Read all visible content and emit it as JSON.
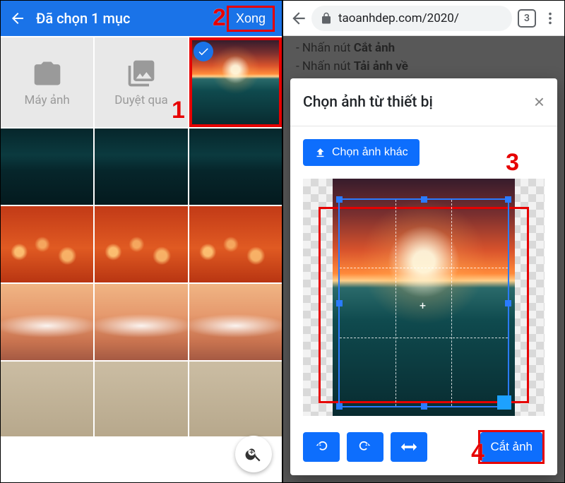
{
  "left": {
    "title": "Đã chọn 1 mục",
    "done": "Xong",
    "camera_label": "Máy ảnh",
    "browse_label": "Duyệt qua"
  },
  "right": {
    "url": "taoanhdep.com/2020/",
    "tab_count": "3",
    "page_bullet1_prefix": "- Nhấn nút ",
    "page_bullet1_bold": "Cắt ảnh",
    "page_bullet2_prefix": "- Nhấn nút ",
    "page_bullet2_bold": "Tải ảnh về",
    "modal_title": "Chọn ảnh từ thiết bị",
    "choose_other": "Chọn ảnh khác",
    "crop_label": "Cắt ảnh"
  },
  "steps": {
    "s1": "1",
    "s2": "2",
    "s3": "3",
    "s4": "4"
  }
}
